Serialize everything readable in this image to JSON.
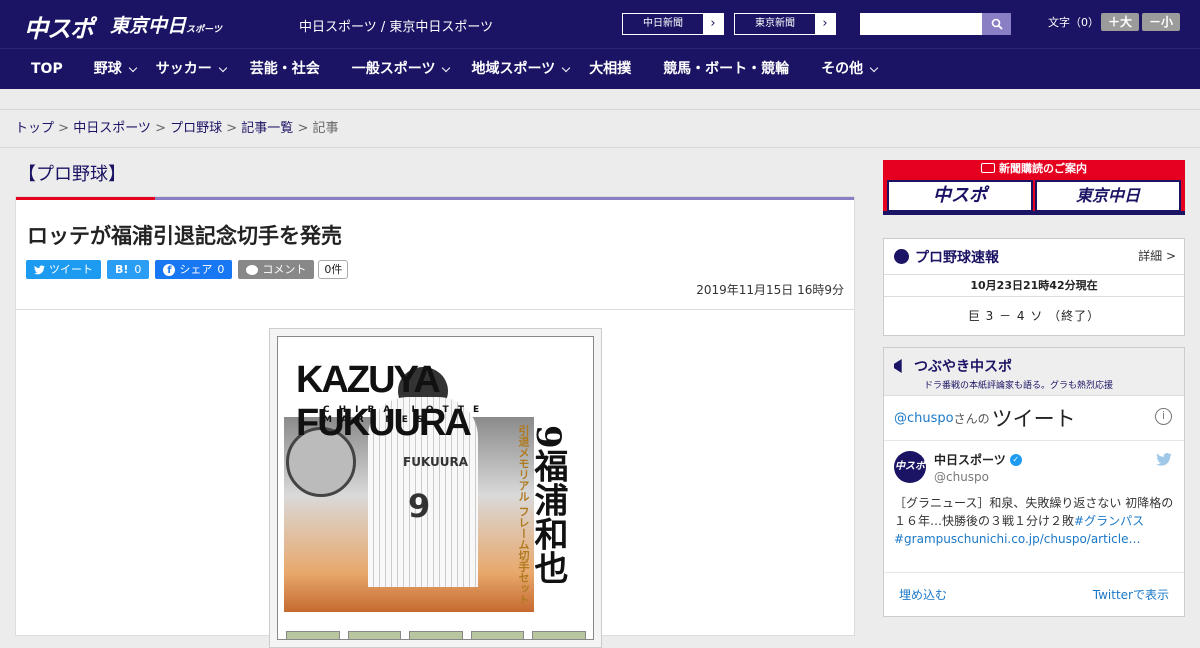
{
  "header": {
    "logo_main": "中スポ",
    "logo_tokyo": "東京中日",
    "logo_tokyo_small": "スポーツ",
    "site_name": "中日スポーツ / 東京中日スポーツ",
    "newspaper_buttons": [
      {
        "label": "中日新聞"
      },
      {
        "label": "東京新聞"
      }
    ],
    "search": {
      "placeholder": ""
    },
    "font_size_label": "文字（0）",
    "font_plus": "＋大",
    "font_minus": "－小"
  },
  "nav": {
    "items": [
      {
        "label": "TOP",
        "dropdown": false
      },
      {
        "label": "野球",
        "dropdown": true
      },
      {
        "label": "サッカー",
        "dropdown": true
      },
      {
        "label": "芸能・社会",
        "dropdown": false
      },
      {
        "label": "一般スポーツ",
        "dropdown": true
      },
      {
        "label": "地域スポーツ",
        "dropdown": true
      },
      {
        "label": "大相撲",
        "dropdown": false
      },
      {
        "label": "競馬・ボート・競輪",
        "dropdown": false
      },
      {
        "label": "その他",
        "dropdown": true
      }
    ]
  },
  "breadcrumb": {
    "items": [
      "トップ",
      "中日スポーツ",
      "プロ野球",
      "記事一覧"
    ],
    "current": "記事",
    "separator": " > "
  },
  "article": {
    "category": "【プロ野球】",
    "title": "ロッテが福浦引退記念切手を発売",
    "social": {
      "tweet": "ツイート",
      "hatena": "B!",
      "hatena_count": "0",
      "share": "シェア",
      "share_count": "0",
      "comment": "コメント",
      "comment_count": "0件"
    },
    "date": "2019年11月15日 16時9分",
    "photo": {
      "name": "KAZUYA FUKUURA",
      "team": "CHIBA LOTTE MARINES",
      "jersey": "FUKUURA",
      "number": "9",
      "kanji": "9福浦和也",
      "vertical_sub": "引退メモリアル フレーム切手セット"
    }
  },
  "sidebar": {
    "subscription": {
      "title": "新聞購読のご案内",
      "left": "中スポ",
      "right": "東京中日"
    },
    "score_box": {
      "title": "プロ野球速報",
      "detail": "詳細 >",
      "datetime": "10月23日21時42分現在",
      "result": "巨 3 － 4 ソ （終了）"
    },
    "tweet_box": {
      "title": "つぶやき中スポ",
      "subtitle": "ドラ番戦の本紙評論家も語る。グラも熱烈応援",
      "handle_link": "@chuspo",
      "san_no": "さんの",
      "tweets_label": "ツイート",
      "account_name": "中日スポーツ",
      "account_handle": "@chuspo",
      "avatar_text": "中スポ",
      "tweet_text": "［グラニュース］和泉、失敗繰り返さない 初降格の１６年…快勝後の３戦１分け２敗",
      "tweet_tag": "#グランパス",
      "tweet_link": "#grampuschunichi.co.jp/chuspo/article…",
      "embed": "埋め込む",
      "view_on_twitter": "Twitterで表示"
    }
  },
  "colors": {
    "brand_navy": "#1b1464",
    "accent_red": "#e60020",
    "accent_purple": "#8a7fc4",
    "twitter_blue": "#1d9bf0",
    "hatena_blue": "#2a9df4",
    "facebook_blue": "#1877f2",
    "comment_gray": "#888888"
  }
}
